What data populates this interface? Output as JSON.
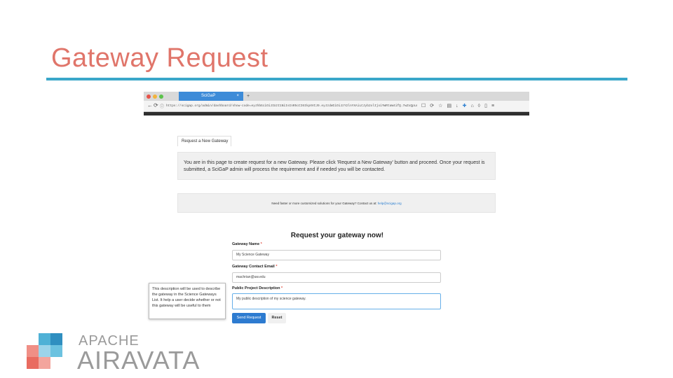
{
  "slide": {
    "title": "Gateway Request",
    "title_color": "#e0756a",
    "rule_color": "#3aa7c9"
  },
  "browser": {
    "tab_title": "SciGaP",
    "tab_close": "×",
    "new_tab": "+",
    "url": "https://scigap.org/admin/dashboard/show-code=eyJhbGciOiJIUzI1NiIsInR5cCI6IkpXVCJ9.eyJzdWIiOiJzY2lnYXAiLCJyb2xlIjoiYWRtaW4ifQ.7wZxQpLmN2VvBc5Xh3KjRtUyQaS8dFgH",
    "back": "←",
    "reload": "⟳",
    "info": "ⓘ",
    "accent": "#3d8bd8"
  },
  "page": {
    "request_tab_label": "Request a New Gateway",
    "info_text": "You are in this page to create request for a new Gateway. Please click 'Request a New Gateway' button and proceed. Once your request is submitted, a SciGaP admin will process the requirement and if needed you will be contacted.",
    "support_text": "Need faster or more customized solutions for your Gateway? Contact us at:",
    "support_email": "help@scigap.org",
    "form_heading": "Request your gateway now!",
    "fields": [
      {
        "label": "Gateway Name",
        "value": "My Science Gateway"
      },
      {
        "label": "Gateway Contact Email",
        "value": "machrian@uw.edu"
      },
      {
        "label": "Public Project Description",
        "value": "My public description of my science gateway."
      }
    ],
    "required_mark": "*",
    "send_button": "Send Request",
    "reset_button": "Reset",
    "tooltip": "This description will be used to describe the gateway in the Science Gateways List. It help a user decide whether or not this gateway will be useful to them"
  },
  "logo": {
    "apache": "APACHE",
    "airavata": "AIRAVATA"
  }
}
